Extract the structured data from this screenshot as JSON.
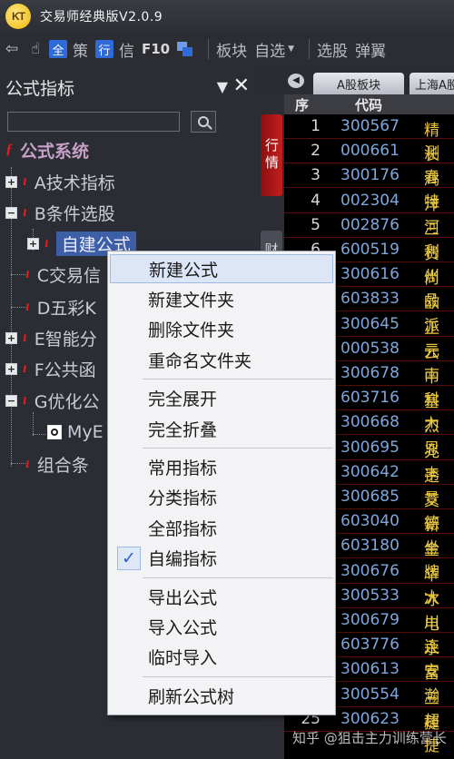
{
  "app": {
    "logo": "KT",
    "title": "交易师经典版V2.0.9"
  },
  "toolbar": {
    "items": [
      {
        "icon": "back-arrow-icon",
        "glyph": "⇦"
      },
      {
        "icon": "hand-cursor-icon",
        "glyph": "☝"
      }
    ],
    "quote_all": "全",
    "strategy": "策",
    "market": "行",
    "info": "信",
    "f10": "F10",
    "sector": "板块",
    "watchlist": "自选",
    "stock_pick": "选股",
    "trend": "弹翼"
  },
  "left_panel": {
    "title": "公式指标",
    "search": {
      "value": "",
      "placeholder": ""
    },
    "tree": {
      "root": "公式系统",
      "nodes": [
        {
          "label": "A技术指标",
          "expander": "+"
        },
        {
          "label": "B条件选股",
          "expander": "−"
        },
        {
          "label": "自建公式",
          "expander": "+"
        },
        {
          "label": "C交易信"
        },
        {
          "label": "D五彩K"
        },
        {
          "label": "E智能分",
          "expander": "+"
        },
        {
          "label": "F公共函",
          "expander": "+"
        },
        {
          "label": "G优化公",
          "expander": "−"
        },
        {
          "label": "MyE"
        },
        {
          "label": "组合条"
        }
      ]
    }
  },
  "right_panel": {
    "tabs": [
      {
        "label": "A股板块"
      },
      {
        "label": "上海A股"
      }
    ],
    "side_tabs": [
      {
        "label": "行情"
      },
      {
        "label": "财"
      }
    ],
    "columns": {
      "seq": "序",
      "code": "代码",
      "name": ""
    },
    "rows": [
      {
        "seq": "1",
        "code": "300567",
        "name": "精测"
      },
      {
        "seq": "2",
        "code": "000661",
        "name": "长春"
      },
      {
        "seq": "3",
        "code": "300176",
        "name": "鸿特"
      },
      {
        "seq": "4",
        "code": "002304",
        "name": "洋河"
      },
      {
        "seq": "5",
        "code": "002876",
        "name": "三利"
      },
      {
        "seq": "6",
        "code": "600519",
        "name": "贵州"
      },
      {
        "seq": "7",
        "code": "300616",
        "name": "尚品"
      },
      {
        "seq": "8",
        "code": "603833",
        "name": "欧派"
      },
      {
        "seq": "9",
        "code": "300645",
        "name": "正元"
      },
      {
        "seq": "10",
        "code": "000538",
        "name": "云南"
      },
      {
        "seq": "11",
        "code": "300678",
        "name": "中科"
      },
      {
        "seq": "12",
        "code": "603716",
        "name": "塞力"
      },
      {
        "seq": "13",
        "code": "300668",
        "name": "杰恩"
      },
      {
        "seq": "14",
        "code": "300695",
        "name": "兆丰"
      },
      {
        "seq": "15",
        "code": "300642",
        "name": "透景"
      },
      {
        "seq": "16",
        "code": "300685",
        "name": "艾德"
      },
      {
        "seq": "17",
        "code": "603040",
        "name": "新坐"
      },
      {
        "seq": "18",
        "code": "603180",
        "name": "金牌"
      },
      {
        "seq": "19",
        "code": "300676",
        "name": "华大"
      },
      {
        "seq": "20",
        "code": "300533",
        "name": "冰川"
      },
      {
        "seq": "21",
        "code": "300679",
        "name": "电连"
      },
      {
        "seq": "22",
        "code": "603776",
        "name": "永安"
      },
      {
        "seq": "23",
        "code": "300613",
        "name": "富瀚"
      },
      {
        "seq": "24",
        "code": "300554",
        "name": "三超"
      },
      {
        "seq": "25",
        "code": "300623",
        "name": "捷捷"
      }
    ]
  },
  "context_menu": {
    "groups": [
      [
        "新建公式",
        "新建文件夹",
        "删除文件夹",
        "重命名文件夹"
      ],
      [
        "完全展开",
        "完全折叠"
      ],
      [
        "常用指标",
        "分类指标",
        "全部指标",
        "自编指标"
      ],
      [
        "导出公式",
        "导入公式",
        "临时导入"
      ],
      [
        "刷新公式树"
      ]
    ],
    "checked": "自编指标",
    "check_glyph": "✓"
  },
  "watermark": "知乎 @狙击主力训练营长"
}
